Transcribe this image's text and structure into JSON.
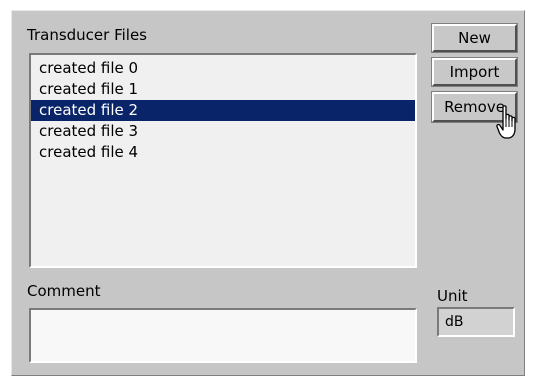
{
  "files": {
    "label": "Transducer Files",
    "items": [
      {
        "label": "created file 0"
      },
      {
        "label": "created file 1"
      },
      {
        "label": "created file 2"
      },
      {
        "label": "created file 3"
      },
      {
        "label": "created file 4"
      }
    ],
    "selected_index": 2,
    "selected_color": "#0a2469"
  },
  "buttons": {
    "new_label": "New",
    "import_label": "Import",
    "remove_label": "Remove"
  },
  "comment": {
    "label": "Comment",
    "value": ""
  },
  "unit": {
    "label": "Unit",
    "value": "dB"
  },
  "cursor": {
    "icon": "hand-pointer-icon"
  }
}
